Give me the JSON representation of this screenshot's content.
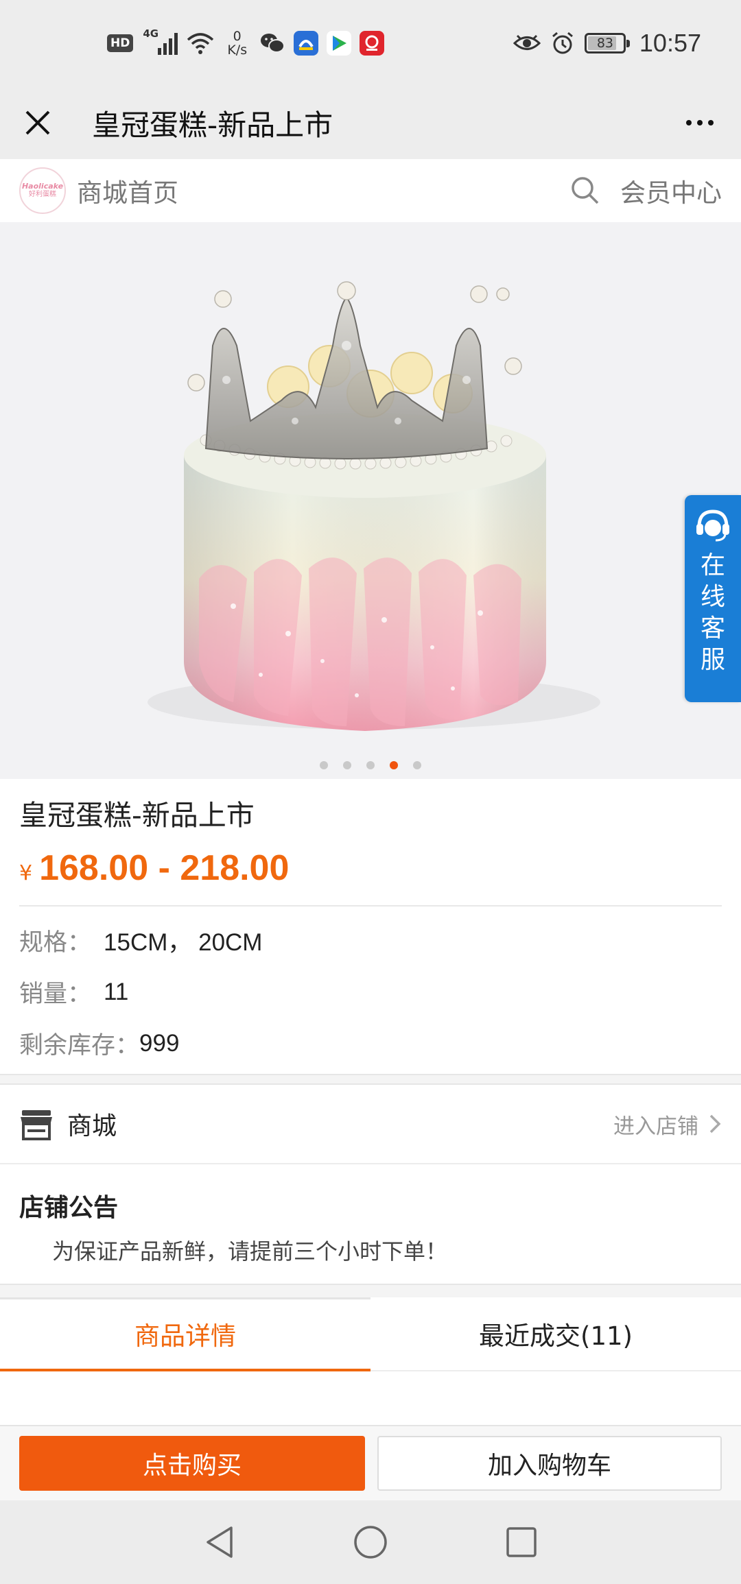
{
  "status_bar": {
    "hd": "HD",
    "network": "4G",
    "speed_value": "0",
    "speed_unit": "K/s",
    "battery": "83",
    "battery_level": 0.83,
    "time": "10:57"
  },
  "title_bar": {
    "title": "皇冠蛋糕-新品上市"
  },
  "shop_header": {
    "logo_line1": "Haolicake",
    "logo_line2": "好利蛋糕",
    "home_label": "商城首页",
    "member_label": "会员中心"
  },
  "gallery": {
    "slide_count": 5,
    "active_index": 3,
    "customer_service": "在线客服"
  },
  "product": {
    "title": "皇冠蛋糕-新品上市",
    "currency": "¥",
    "price": "168.00 - 218.00",
    "spec_label": "规格：",
    "spec_value": "15CM， 20CM",
    "sales_label": "销量：",
    "sales_value": "11",
    "stock_label": "剩余库存：",
    "stock_value": "999"
  },
  "store": {
    "name": "商城",
    "enter_label": "进入店铺"
  },
  "notice": {
    "heading": "店铺公告",
    "text": "为保证产品新鲜，请提前三个小时下单！"
  },
  "tabs": [
    {
      "label": "商品详情",
      "active": true
    },
    {
      "label": "最近成交(11)",
      "active": false
    }
  ],
  "actions": {
    "buy_label": "点击购买",
    "cart_label": "加入购物车"
  },
  "colors": {
    "accent": "#f0680e",
    "buy_button": "#f05a0e",
    "cs_blue": "#1a7ed6"
  }
}
